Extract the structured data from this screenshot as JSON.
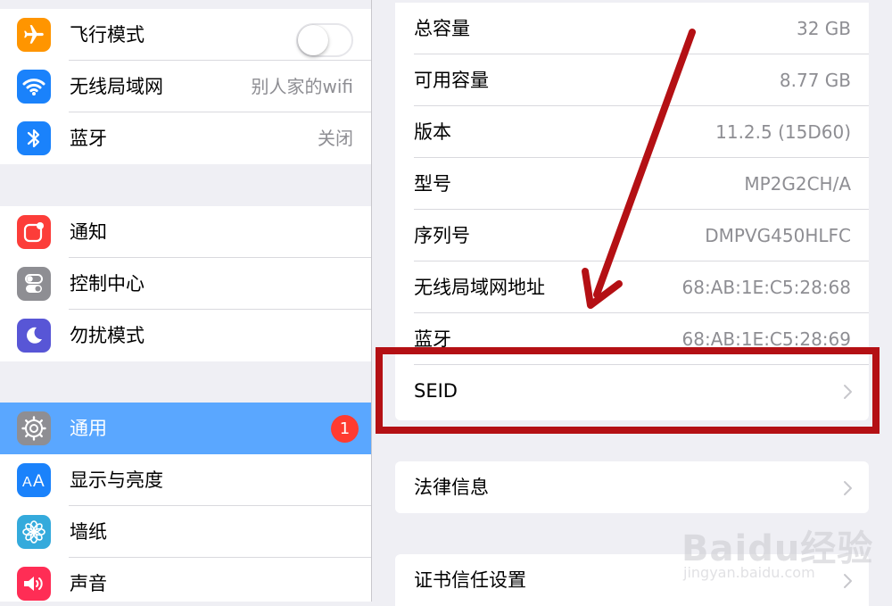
{
  "sidebar": {
    "groups": [
      {
        "items": [
          {
            "label": "飞行模式",
            "icon": "airplane-icon",
            "icon_color": "#ff9500",
            "control": "toggle",
            "toggle_on": false
          },
          {
            "label": "无线局域网",
            "icon": "wifi-icon",
            "icon_color": "#1a82fb",
            "value": "别人家的wifi"
          },
          {
            "label": "蓝牙",
            "icon": "bluetooth-icon",
            "icon_color": "#1a82fb",
            "value": "关闭"
          }
        ]
      },
      {
        "items": [
          {
            "label": "通知",
            "icon": "notifications-icon",
            "icon_color": "#fc3d39"
          },
          {
            "label": "控制中心",
            "icon": "control-center-icon",
            "icon_color": "#8e8e93"
          },
          {
            "label": "勿扰模式",
            "icon": "moon-icon",
            "icon_color": "#5856d6"
          }
        ]
      },
      {
        "items": [
          {
            "label": "通用",
            "icon": "gear-icon",
            "icon_color": "#8e8e93",
            "badge": "1",
            "selected": true
          },
          {
            "label": "显示与亮度",
            "icon": "text-size-icon",
            "icon_color": "#1a82fb"
          },
          {
            "label": "墙纸",
            "icon": "flower-icon",
            "icon_color": "#34aadc"
          },
          {
            "label": "声音",
            "icon": "speaker-icon",
            "icon_color": "#ff2d55"
          }
        ]
      }
    ],
    "selected_color": "#5aa7ff",
    "badge_color": "#ff3b30"
  },
  "about": {
    "rows": [
      {
        "label": "总容量",
        "value": "32 GB"
      },
      {
        "label": "可用容量",
        "value": "8.77 GB"
      },
      {
        "label": "版本",
        "value": "11.2.5 (15D60)"
      },
      {
        "label": "型号",
        "value": "MP2G2CH/A"
      },
      {
        "label": "序列号",
        "value": "DMPVG450HLFC"
      },
      {
        "label": "无线局域网地址",
        "value": "68:AB:1E:C5:28:68"
      },
      {
        "label": "蓝牙",
        "value": "68:AB:1E:C5:28:69"
      }
    ],
    "seid_label": "SEID",
    "legal_label": "法律信息",
    "cert_label": "证书信任设置"
  },
  "annotation": {
    "color": "#b41014",
    "shapes": [
      "arrow",
      "highlight-box"
    ]
  },
  "watermark": {
    "main": "Baidu经验",
    "sub": "jingyan.baidu.com"
  }
}
